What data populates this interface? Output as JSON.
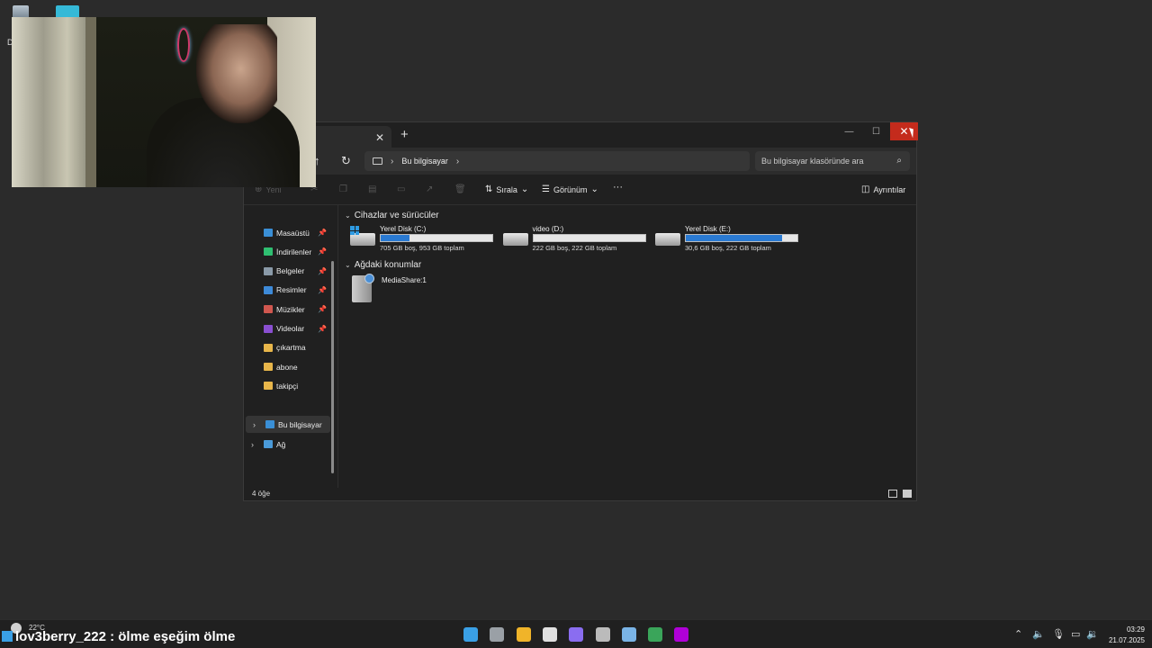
{
  "desktop": {
    "icons": [
      "recycle-bin-icon",
      "folder-icon"
    ],
    "partial_label": "D"
  },
  "explorer": {
    "tab": {
      "close_glyph": "✕",
      "new_glyph": "+"
    },
    "window_buttons": {
      "minimize": "—",
      "maximize": "☐",
      "close": "✕"
    },
    "nav": {
      "up": "↑",
      "refresh": "↻"
    },
    "breadcrumb": {
      "location": "Bu bilgisayar",
      "chevron": "›"
    },
    "search": {
      "placeholder": "Bu bilgisayar klasöründe ara",
      "icon": "⌕"
    },
    "toolbar": {
      "new_label": "Yeni",
      "sort_label": "Sırala",
      "view_label": "Görünüm",
      "more_label": "···",
      "details_label": "Ayrıntılar"
    },
    "sidebar": {
      "quick": [
        {
          "label": "Masaüstü",
          "icon": "desktop-icon",
          "color": "#3a8fd6",
          "pinned": true
        },
        {
          "label": "İndirilenler",
          "icon": "download-icon",
          "color": "#2fbf71",
          "pinned": true
        },
        {
          "label": "Belgeler",
          "icon": "documents-icon",
          "color": "#8a9aa8",
          "pinned": true
        },
        {
          "label": "Resimler",
          "icon": "pictures-icon",
          "color": "#3d8ad8",
          "pinned": true
        },
        {
          "label": "Müzikler",
          "icon": "music-icon",
          "color": "#d0574f",
          "pinned": true
        },
        {
          "label": "Videolar",
          "icon": "videos-icon",
          "color": "#8a4fd1",
          "pinned": true
        },
        {
          "label": "çıkartma",
          "icon": "folder-icon",
          "color": "#e8b64a",
          "pinned": false
        },
        {
          "label": "abone",
          "icon": "folder-icon",
          "color": "#e8b64a",
          "pinned": false
        },
        {
          "label": "takipçi",
          "icon": "folder-icon",
          "color": "#e8b64a",
          "pinned": false
        }
      ],
      "this_pc": "Bu bilgisayar",
      "network": "Ağ",
      "pin_glyph": "📌"
    },
    "groups": {
      "devices": "Cihazlar ve sürücüler",
      "network": "Ağdaki konumlar"
    },
    "drives": [
      {
        "name": "Yerel Disk (C:)",
        "info": "705 GB boş, 953 GB toplam",
        "used_fraction": 0.26,
        "system": true
      },
      {
        "name": "video (D:)",
        "info": "222 GB boş, 222 GB toplam",
        "used_fraction": 0.0,
        "system": false
      },
      {
        "name": "Yerel Disk (E:)",
        "info": "30,6 GB boş, 222 GB toplam",
        "used_fraction": 0.86,
        "system": false
      }
    ],
    "network_locations": [
      {
        "name": "MediaShare:1"
      }
    ],
    "status": {
      "count": "4 öğe"
    }
  },
  "taskbar": {
    "weather": "22°C",
    "chat_overlay": "lov3berry_222 : ölme eşeğim ölme",
    "pinned_apps": [
      {
        "name": "start-icon",
        "color": "#3aa0e6"
      },
      {
        "name": "task-view-icon",
        "color": "#9aa0a6"
      },
      {
        "name": "file-explorer-icon",
        "color": "#f0b429"
      },
      {
        "name": "epic-games-icon",
        "color": "#e0e0e0"
      },
      {
        "name": "copilot-icon",
        "color": "#8a6df0"
      },
      {
        "name": "app-icon",
        "color": "#bbbbbb"
      },
      {
        "name": "steam-icon",
        "color": "#7ab4e6"
      },
      {
        "name": "chrome-icon",
        "color": "#3aa55a"
      },
      {
        "name": "twitch-icon",
        "color": "#b000d8"
      }
    ],
    "clock": {
      "time": "03:29",
      "date": "21.07.2025"
    }
  }
}
